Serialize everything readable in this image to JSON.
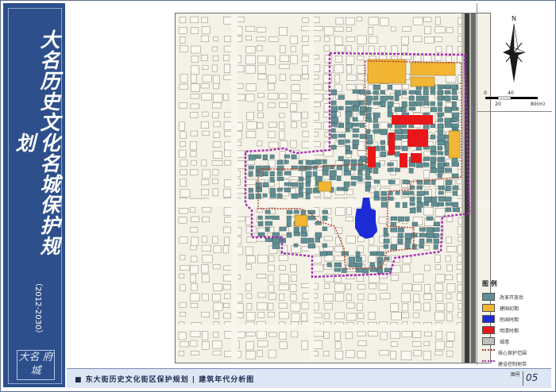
{
  "banner": {
    "title": "大名历史文化名城保护规划",
    "years": "（2012-2030）",
    "seal_text": "大名 府城"
  },
  "map": {
    "north_label": "N",
    "scale_labels": [
      "0",
      "20",
      "40",
      "80(m)"
    ],
    "colors": {
      "background": "#f4f1e6",
      "street_block": "#cfcab8",
      "reform_era": "#5f8f94",
      "early_republic": "#f2b634",
      "republic": "#1c2bd6",
      "ming_qing": "#e8181a",
      "city_wall": "#3a3a3a",
      "core_boundary": "#b0402a",
      "control_boundary": "#a52bb3"
    }
  },
  "legend": {
    "title": "图 例",
    "items": [
      {
        "label": "改革开放后",
        "color": "#5f8f94",
        "kind": "fill"
      },
      {
        "label": "建国初期",
        "color": "#f2b634",
        "kind": "fill"
      },
      {
        "label": "民国时期",
        "color": "#1c2bd6",
        "kind": "fill"
      },
      {
        "label": "明清时期",
        "color": "#e8181a",
        "kind": "fill"
      },
      {
        "label": "城墙",
        "color": "#bfbfbf",
        "kind": "fill"
      },
      {
        "label": "核心保护范围",
        "color": "#b0402a",
        "kind": "line"
      },
      {
        "label": "建设控制地带",
        "color": "#a52bb3",
        "kind": "line"
      }
    ]
  },
  "footer": {
    "text": "■  东大街历史文化街区保护规划 | 建筑年代分析图",
    "sheet_label": "图号",
    "sheet_number": "05"
  }
}
